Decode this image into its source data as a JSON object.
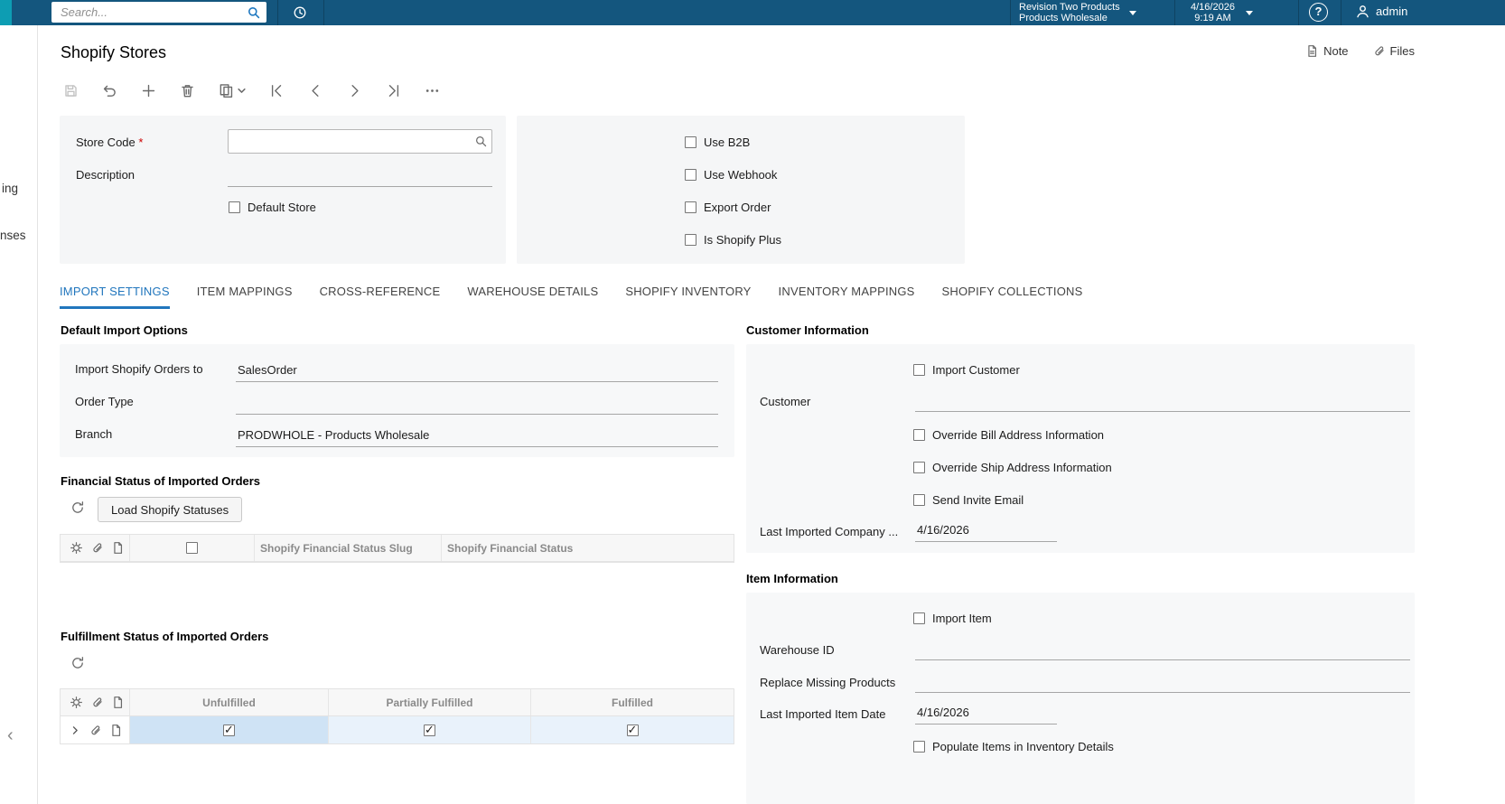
{
  "colors": {
    "header_bar": "#14567E",
    "header_accent": "#0D9DB3",
    "active_tab": "#2176BD",
    "selected_cell": "#CFE3F5",
    "selected_row": "#E9F2FB"
  },
  "header": {
    "search_placeholder": "Search...",
    "company_line1": "Revision Two Products",
    "company_line2": "Products Wholesale",
    "date": "4/16/2026",
    "time": "9:19 AM",
    "user": "admin"
  },
  "sidebar": {
    "fragment_top": "ing",
    "fragment_bottom": "nses",
    "collapse": "‹"
  },
  "page": {
    "title": "Shopify Stores",
    "note": "Note",
    "files": "Files"
  },
  "toolbar": {
    "icons": [
      "save",
      "undo",
      "add",
      "delete",
      "copy",
      "first",
      "previous",
      "next",
      "last",
      "more"
    ]
  },
  "summary": {
    "store_code_label": "Store Code",
    "description_label": "Description",
    "default_store_label": "Default Store",
    "flags": [
      {
        "label": "Use B2B",
        "checked": false
      },
      {
        "label": "Use Webhook",
        "checked": false
      },
      {
        "label": "Export Order",
        "checked": false
      },
      {
        "label": "Is Shopify Plus",
        "checked": false
      }
    ]
  },
  "tabs": [
    {
      "label": "IMPORT SETTINGS",
      "active": true
    },
    {
      "label": "ITEM MAPPINGS",
      "active": false
    },
    {
      "label": "CROSS-REFERENCE",
      "active": false
    },
    {
      "label": "WAREHOUSE DETAILS",
      "active": false
    },
    {
      "label": "SHOPIFY INVENTORY",
      "active": false
    },
    {
      "label": "INVENTORY MAPPINGS",
      "active": false
    },
    {
      "label": "SHOPIFY COLLECTIONS",
      "active": false
    }
  ],
  "default_import_options": {
    "title": "Default Import Options",
    "fields": [
      {
        "label": "Import Shopify Orders to",
        "value": "SalesOrder"
      },
      {
        "label": "Order Type",
        "value": ""
      },
      {
        "label": "Branch",
        "value": "PRODWHOLE - Products Wholesale"
      }
    ]
  },
  "financial_status": {
    "title": "Financial Status of Imported Orders",
    "load_button": "Load Shopify Statuses",
    "columns": [
      "Shopify Financial Status Slug",
      "Shopify Financial Status"
    ]
  },
  "fulfillment_status": {
    "title": "Fulfillment Status of Imported Orders",
    "columns": [
      "Unfulfilled",
      "Partially Fulfilled",
      "Fulfilled"
    ],
    "row": {
      "unfulfilled": true,
      "partially_fulfilled": true,
      "fulfilled": true
    }
  },
  "customer_information": {
    "title": "Customer Information",
    "import_customer": {
      "label": "Import Customer",
      "checked": false
    },
    "customer_label": "Customer",
    "customer_value": "",
    "override_bill": {
      "label": "Override Bill Address Information",
      "checked": false
    },
    "override_ship": {
      "label": "Override Ship Address Information",
      "checked": false
    },
    "send_invite": {
      "label": "Send Invite Email",
      "checked": false
    },
    "last_imported_company_label": "Last Imported Company ...",
    "last_imported_company_value": "4/16/2026"
  },
  "item_information": {
    "title": "Item Information",
    "import_item": {
      "label": "Import Item",
      "checked": false
    },
    "warehouse_id_label": "Warehouse ID",
    "warehouse_id_value": "",
    "replace_missing_label": "Replace Missing Products",
    "replace_missing_value": "",
    "last_imported_item_label": "Last Imported Item Date",
    "last_imported_item_value": "4/16/2026",
    "populate_items": {
      "label": "Populate Items in Inventory Details",
      "checked": false
    }
  }
}
